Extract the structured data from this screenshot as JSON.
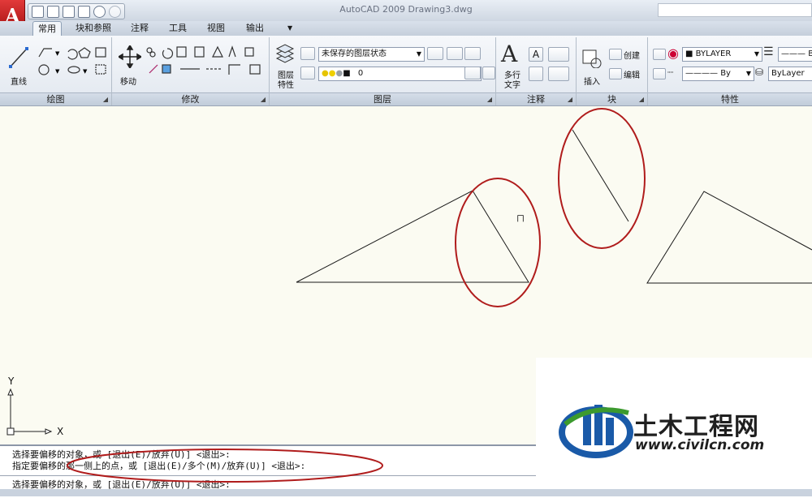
{
  "window": {
    "title": "AutoCAD 2009 Drawing3.dwg",
    "logo_letter": "A"
  },
  "tabs": [
    {
      "label": "常用",
      "active": true
    },
    {
      "label": "块和参照",
      "active": false
    },
    {
      "label": "注释",
      "active": false
    },
    {
      "label": "工具",
      "active": false
    },
    {
      "label": "视图",
      "active": false
    },
    {
      "label": "输出",
      "active": false
    }
  ],
  "ribbon": {
    "draw": {
      "title": "绘图",
      "line_label": "直线"
    },
    "modify": {
      "title": "修改",
      "move_label": "移动"
    },
    "layers": {
      "title": "图层",
      "properties_label_1": "图层",
      "properties_label_2": "特性",
      "state_dropdown": "未保存的图层状态",
      "current_layer": "0"
    },
    "annotation": {
      "title": "注释",
      "mtext_label_1": "多行",
      "mtext_label_2": "文字"
    },
    "block": {
      "title": "块",
      "insert_label": "插入",
      "create_label": "创建",
      "edit_label": "编辑"
    },
    "properties": {
      "title": "特性",
      "color_dropdown": "BYLAYER",
      "linetype_dropdown": "By",
      "lineweight_dropdown": "ByLayer",
      "truncated_label": "B"
    }
  },
  "canvas": {
    "ucs_x": "X",
    "ucs_y": "Y",
    "cursor_glyph": "ㄇ"
  },
  "command": {
    "history_1": "选择要偏移的对象，或 [退出(E)/放弃(U)] <退出>:",
    "history_2": "指定要偏移的那一侧上的点，或 [退出(E)/多个(M)/放弃(U)] <退出>:",
    "prompt": "选择要偏移的对象，或 [退出(E)/放弃(U)] <退出>:"
  },
  "watermark": {
    "name": "土木工程网",
    "url": "www.civilcn.com"
  },
  "colors": {
    "annotation_red": "#b01c1c",
    "watermark_blue": "#1a5aa8",
    "watermark_green": "#3c9a2e"
  }
}
